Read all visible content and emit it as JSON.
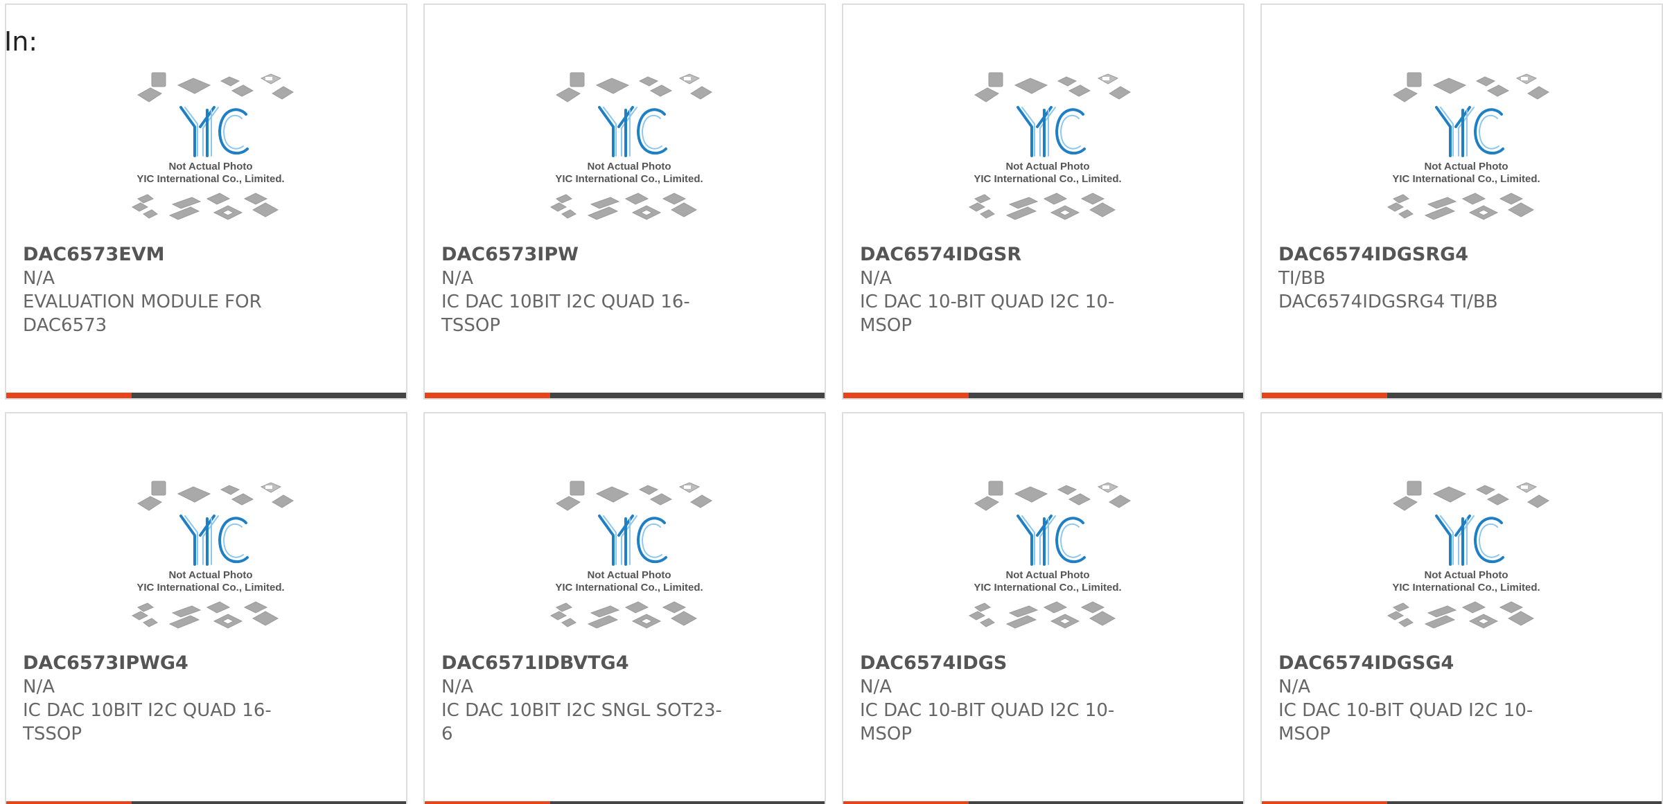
{
  "prefix": "In:",
  "placeholder_image": {
    "line1": "Not Actual Photo",
    "line2": "YIC International Co., Limited.",
    "logo_text": "YIC",
    "colors": {
      "logo": "#1f7fc4",
      "chips": "#a8a8a8"
    }
  },
  "colors": {
    "accent_bar": "#e8441a",
    "dark_bar": "#444444"
  },
  "products": [
    {
      "part_number": "DAC6573EVM",
      "manufacturer": "N/A",
      "description": "EVALUATION MODULE FOR DAC6573"
    },
    {
      "part_number": "DAC6573IPW",
      "manufacturer": "N/A",
      "description": "IC DAC 10BIT I2C QUAD 16-TSSOP"
    },
    {
      "part_number": "DAC6574IDGSR",
      "manufacturer": "N/A",
      "description": "IC DAC 10-BIT QUAD I2C 10-MSOP"
    },
    {
      "part_number": "DAC6574IDGSRG4",
      "manufacturer": "TI/BB",
      "description": "DAC6574IDGSRG4 TI/BB"
    },
    {
      "part_number": "DAC6573IPWG4",
      "manufacturer": "N/A",
      "description": "IC DAC 10BIT I2C QUAD 16-TSSOP"
    },
    {
      "part_number": "DAC6571IDBVTG4",
      "manufacturer": "N/A",
      "description": "IC DAC 10BIT I2C SNGL SOT23-6"
    },
    {
      "part_number": "DAC6574IDGS",
      "manufacturer": "N/A",
      "description": "IC DAC 10-BIT QUAD I2C 10-MSOP"
    },
    {
      "part_number": "DAC6574IDGSG4",
      "manufacturer": "N/A",
      "description": "IC DAC 10-BIT QUAD I2C 10-MSOP"
    }
  ]
}
